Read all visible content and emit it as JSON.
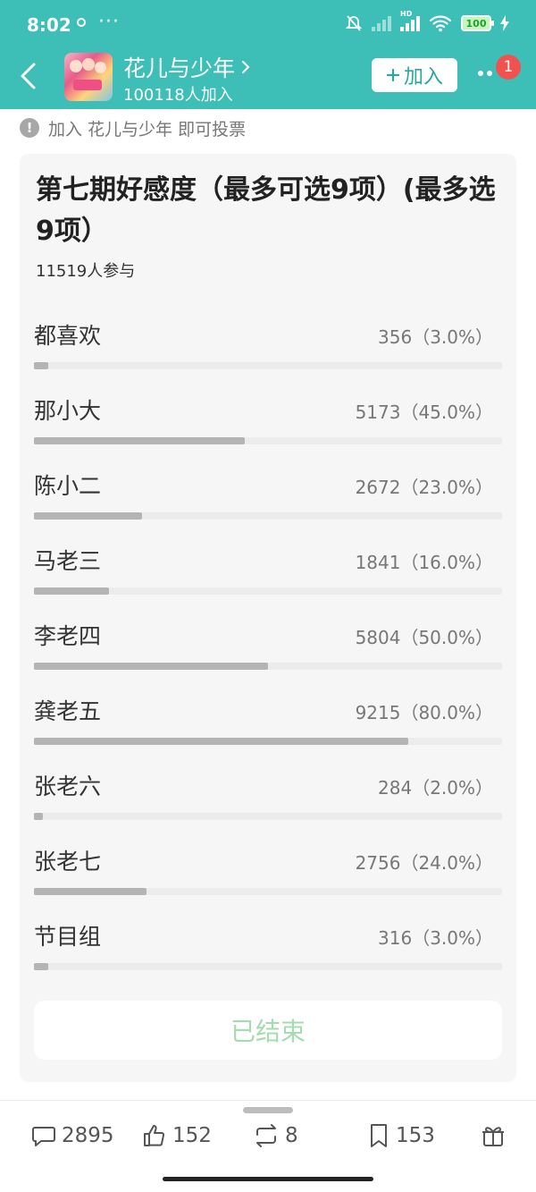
{
  "status_bar": {
    "time": "8:02",
    "more": "···",
    "hd_label": "HD",
    "battery": "100"
  },
  "group": {
    "name": "花儿与少年",
    "members": "100118人加入",
    "join_label": "加入",
    "notification_count": "1"
  },
  "vote_hint": "加入 花儿与少年 即可投票",
  "poll": {
    "title": "第七期好感度（最多可选9项）(最多选9项）",
    "participants": "11519人参与",
    "options": [
      {
        "name": "都喜欢",
        "count": "356（3.0%）",
        "percent": 3.0
      },
      {
        "name": "那小大",
        "count": "5173（45.0%）",
        "percent": 45.0
      },
      {
        "name": "陈小二",
        "count": "2672（23.0%）",
        "percent": 23.0
      },
      {
        "name": "马老三",
        "count": "1841（16.0%）",
        "percent": 16.0
      },
      {
        "name": "李老四",
        "count": "5804（50.0%）",
        "percent": 50.0
      },
      {
        "name": "龚老五",
        "count": "9215（80.0%）",
        "percent": 80.0
      },
      {
        "name": "张老六",
        "count": "284（2.0%）",
        "percent": 2.0
      },
      {
        "name": "张老七",
        "count": "2756（24.0%）",
        "percent": 24.0
      },
      {
        "name": "节目组",
        "count": "316（3.0%）",
        "percent": 3.0
      }
    ],
    "ended_label": "已结束"
  },
  "toolbar": {
    "comments": "2895",
    "likes": "152",
    "reposts": "8",
    "bookmarks": "153"
  },
  "colors": {
    "header": "#3dbfb8",
    "join_text": "#2aa7a0",
    "badge": "#f1524f",
    "bar_fill": "#b4b4b4",
    "ended_text": "#a5dbb0"
  },
  "icons": [
    "back-icon",
    "avatar",
    "chevron-right-icon",
    "plus-icon",
    "more-icon",
    "info-icon",
    "comment-icon",
    "like-icon",
    "repost-icon",
    "bookmark-icon",
    "gift-icon"
  ]
}
